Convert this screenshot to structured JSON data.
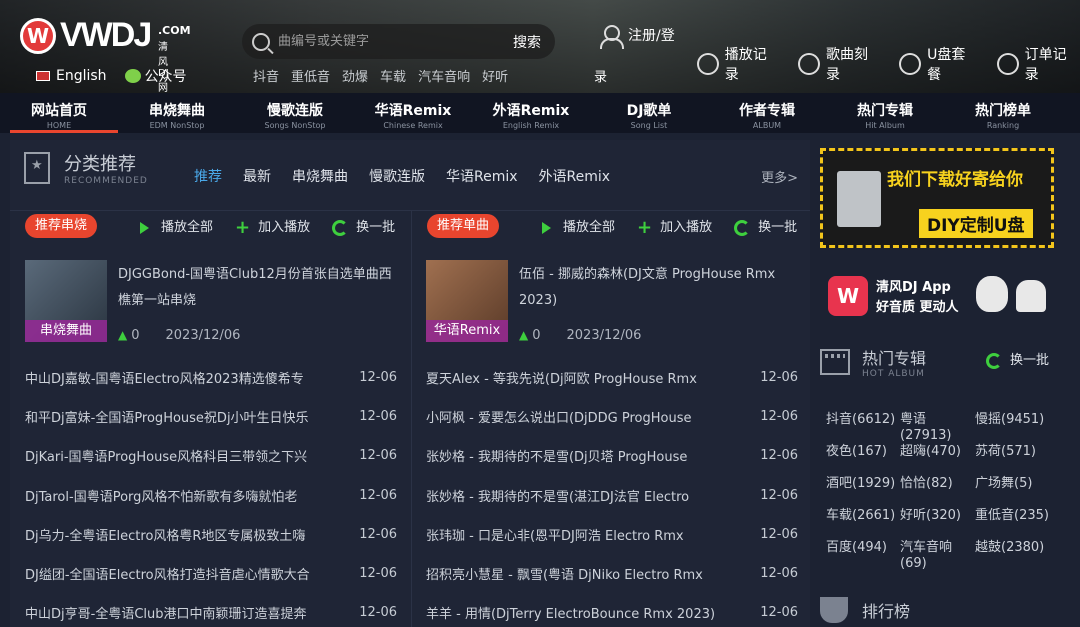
{
  "header": {
    "logo_text": "VWDJ",
    "logo_sub": ".COM",
    "logo_sub2": "清风DJ网",
    "lang_label": "English",
    "wechat_label": "公众号",
    "search_placeholder": "曲编号或关键字",
    "search_button": "搜索",
    "hotwords": [
      "抖音",
      "重低音",
      "劲爆",
      "车载",
      "汽车音响",
      "好听"
    ],
    "login_label": "注册/登",
    "login_label_2": "录",
    "toplinks": [
      "播放记录",
      "歌曲刻录",
      "U盘套餐",
      "订单记录"
    ]
  },
  "nav": [
    {
      "cn": "网站首页",
      "en": "HOME"
    },
    {
      "cn": "串烧舞曲",
      "en": "EDM NonStop"
    },
    {
      "cn": "慢歌连版",
      "en": "Songs NonStop"
    },
    {
      "cn": "华语Remix",
      "en": "Chinese Remix"
    },
    {
      "cn": "外语Remix",
      "en": "English Remix"
    },
    {
      "cn": "DJ歌单",
      "en": "Song List"
    },
    {
      "cn": "作者专辑",
      "en": "ALBUM"
    },
    {
      "cn": "热门专辑",
      "en": "Hit Album"
    },
    {
      "cn": "热门榜单",
      "en": "Ranking"
    }
  ],
  "section": {
    "title": "分类推荐",
    "subtitle": "RECOMMENDED",
    "cats": [
      "推荐",
      "最新",
      "串烧舞曲",
      "慢歌连版",
      "华语Remix",
      "外语Remix"
    ],
    "more": "更多>"
  },
  "controls": {
    "play_all": "播放全部",
    "add_play": "加入播放",
    "refresh": "换一批"
  },
  "left": {
    "badge": "推荐串烧",
    "feat_title": "DJGGBond-国粤语Club12月份首张自选单曲西樵第一站串烧",
    "feat_tag": "串烧舞曲",
    "feat_count": "0",
    "feat_date": "2023/12/06",
    "rows": [
      {
        "title": "中山DJ嘉敏-国粤语Electro风格2023精选傻希专",
        "date": "12-06"
      },
      {
        "title": "和平Dj富妹-全国语ProgHouse祝Dj小叶生日快乐",
        "date": "12-06"
      },
      {
        "title": "DjKari-国粤语ProgHouse风格科目三带领之下兴",
        "date": "12-06"
      },
      {
        "title": "DjTarol-国粤语Porg风格不怕新歌有多嗨就怕老",
        "date": "12-06"
      },
      {
        "title": "Dj乌力-全粤语Electro风格粤R地区专属极致土嗨",
        "date": "12-06"
      },
      {
        "title": "DJ缢团-全国语Electro风格打造抖音虐心情歌大合",
        "date": "12-06"
      },
      {
        "title": "中山Dj亨哥-全粤语Club港口中南颖珊订造喜提奔",
        "date": "12-06"
      }
    ]
  },
  "right": {
    "badge": "推荐单曲",
    "feat_title": "伍佰 - 挪威的森林(DJ文意 ProgHouse Rmx 2023)",
    "feat_tag": "华语Remix",
    "feat_count": "0",
    "feat_date": "2023/12/06",
    "rows": [
      {
        "title": "夏天Alex - 等我先说(Dj阿欧 ProgHouse Rmx",
        "date": "12-06"
      },
      {
        "title": "小阿枫 - 爱要怎么说出口(DjDDG ProgHouse",
        "date": "12-06"
      },
      {
        "title": "张妙格 - 我期待的不是雪(Dj贝塔 ProgHouse",
        "date": "12-06"
      },
      {
        "title": "张妙格 - 我期待的不是雪(湛江DJ法官 Electro",
        "date": "12-06"
      },
      {
        "title": "张玮珈 - 口是心非(恩平DJ阿浩 Electro Rmx",
        "date": "12-06"
      },
      {
        "title": "招积亮小慧星 - 飘雪(粤语 DjNiko Electro Rmx",
        "date": "12-06"
      },
      {
        "title": "羊羊 - 用情(DjTerry ElectroBounce Rmx 2023)",
        "date": "12-06"
      }
    ]
  },
  "side": {
    "banner_t1": "我们下载好寄给你",
    "banner_t2": "DIY定制U盘",
    "app_t1": "清风DJ App",
    "app_t2": "好音质 更动人",
    "hot_title": "热门专辑",
    "hot_sub": "HOT ALBUM",
    "hot_refresh": "换一批",
    "tags": [
      {
        "text": "抖音(6612)",
        "col": 0,
        "row": 0
      },
      {
        "text": "粤语(27913)",
        "col": 1,
        "row": 0
      },
      {
        "text": "慢摇(9451)",
        "col": 2,
        "row": 0
      },
      {
        "text": "夜色(167)",
        "col": 0,
        "row": 1
      },
      {
        "text": "超嗨(470)",
        "col": 1,
        "row": 1
      },
      {
        "text": "苏荷(571)",
        "col": 2,
        "row": 1
      },
      {
        "text": "酒吧(1929)",
        "col": 0,
        "row": 2
      },
      {
        "text": "恰恰(82)",
        "col": 1,
        "row": 2
      },
      {
        "text": "广场舞(5)",
        "col": 2,
        "row": 2
      },
      {
        "text": "车载(2661)",
        "col": 0,
        "row": 3
      },
      {
        "text": "好听(320)",
        "col": 1,
        "row": 3
      },
      {
        "text": "重低音(235)",
        "col": 2,
        "row": 3
      },
      {
        "text": "百度(494)",
        "col": 0,
        "row": 4
      },
      {
        "text": "汽车音响(69)",
        "col": 1,
        "row": 4
      },
      {
        "text": "越鼓(2380)",
        "col": 2,
        "row": 4
      }
    ],
    "rank_title": "排行榜"
  }
}
